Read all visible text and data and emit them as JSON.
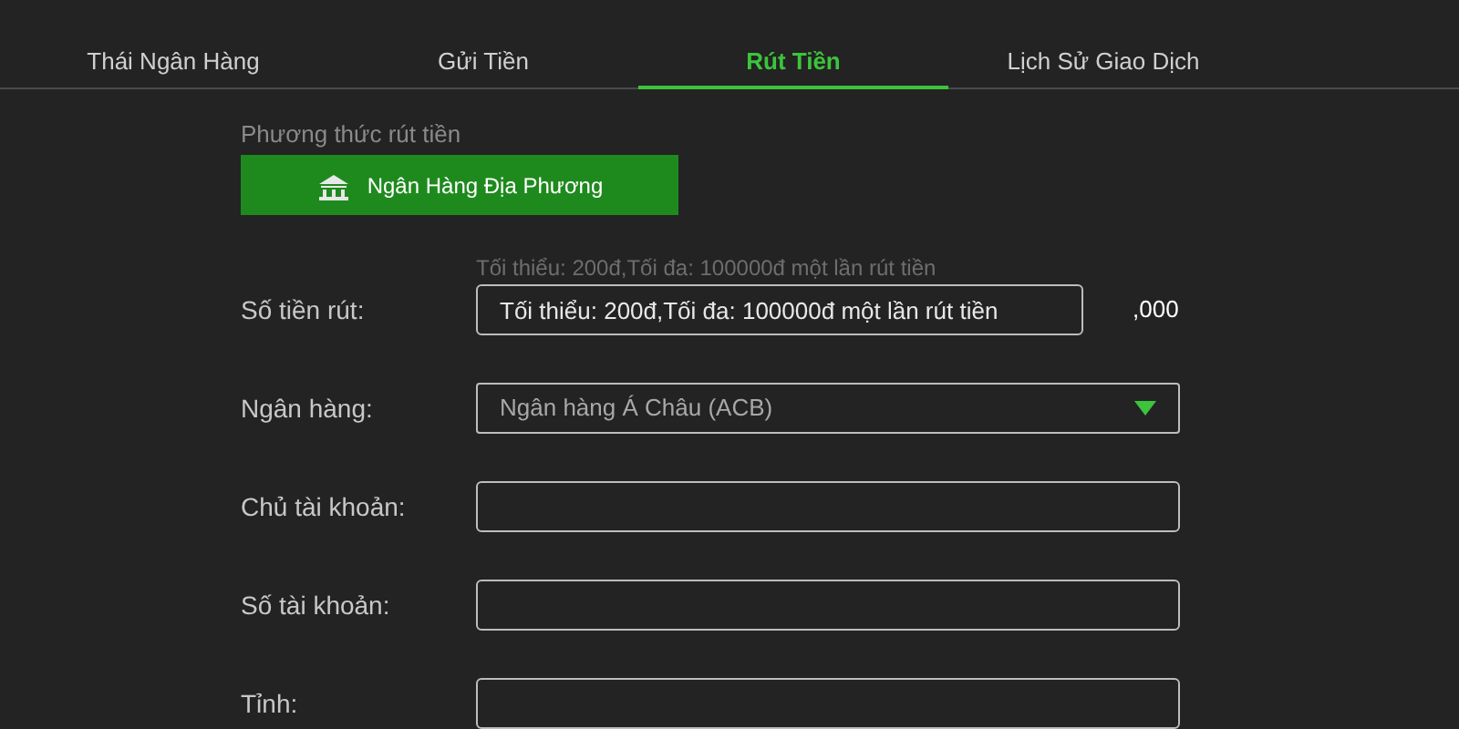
{
  "tabs": [
    {
      "label": "Thái Ngân Hàng",
      "selected": false
    },
    {
      "label": "Gửi Tiền",
      "selected": false
    },
    {
      "label": "Rút Tiền",
      "selected": true
    },
    {
      "label": "Lịch Sử Giao Dịch",
      "selected": false
    }
  ],
  "method": {
    "label": "Phương thức rút tiền",
    "button": "Ngân Hàng Địa Phương"
  },
  "fields": [
    {
      "kind": "amount",
      "label": "Số tiền rút:",
      "hint": "Tối thiểu: 200đ,Tối đa: 100000đ một lần rút tiền",
      "placeholder": "Tối thiểu: 200đ,Tối đa: 100000đ một lần rút tiền",
      "suffix": ",000"
    },
    {
      "kind": "select",
      "label": "Ngân hàng:",
      "value": "Ngân hàng Á Châu (ACB)"
    },
    {
      "kind": "text",
      "label": "Chủ tài khoản:"
    },
    {
      "kind": "text",
      "label": "Số tài khoản:"
    },
    {
      "kind": "text",
      "label": "Tỉnh:"
    }
  ]
}
